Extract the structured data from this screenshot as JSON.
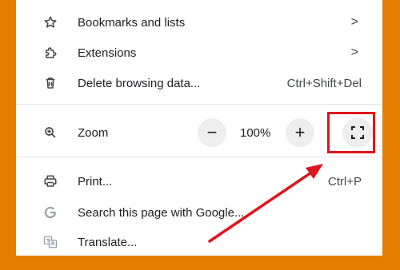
{
  "menu": {
    "bookmarks": {
      "label": "Bookmarks and lists",
      "icon": "star-icon"
    },
    "extensions": {
      "label": "Extensions",
      "icon": "puzzle-icon"
    },
    "delete": {
      "label": "Delete browsing data...",
      "shortcut": "Ctrl+Shift+Del",
      "icon": "trash-icon"
    },
    "zoom": {
      "label": "Zoom",
      "minus": "−",
      "value": "100%",
      "plus": "+",
      "icon": "zoom-icon"
    },
    "print": {
      "label": "Print...",
      "shortcut": "Ctrl+P",
      "icon": "printer-icon"
    },
    "search": {
      "label": "Search this page with Google...",
      "icon": "google-g-icon"
    },
    "translate": {
      "label": "Translate...",
      "icon": "translate-icon"
    }
  },
  "colors": {
    "background": "#e47d00",
    "highlight": "#e0141e"
  }
}
